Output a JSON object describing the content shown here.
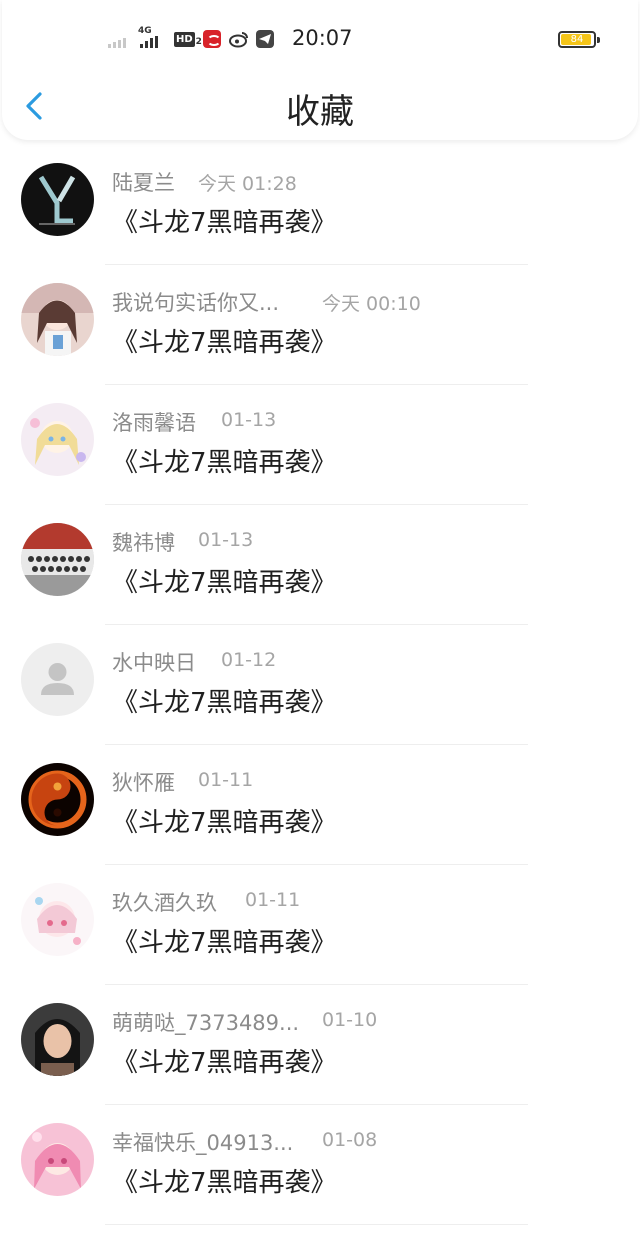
{
  "status_bar": {
    "network": "4G",
    "hd_label": "HD",
    "hd_sub": "2",
    "time": "20:07",
    "battery": "84"
  },
  "header": {
    "title": "收藏",
    "back_icon": "chevron-left-icon",
    "accent_color": "#2b9be0"
  },
  "items": [
    {
      "name": "陆夏兰",
      "date": "今天 01:28",
      "content": "《斗龙7黑暗再袭》",
      "avatar": "logo-y"
    },
    {
      "name": "我说句实话你又...",
      "date": "今天 00:10",
      "content": "《斗龙7黑暗再袭》",
      "avatar": "anime-girl"
    },
    {
      "name": "洛雨馨语",
      "date": "01-13",
      "content": "《斗龙7黑暗再袭》",
      "avatar": "anime-pastel"
    },
    {
      "name": "魏祎博",
      "date": "01-13",
      "content": "《斗龙7黑暗再袭》",
      "avatar": "group-photo"
    },
    {
      "name": "水中映日",
      "date": "01-12",
      "content": "《斗龙7黑暗再袭》",
      "avatar": "default-user"
    },
    {
      "name": "狄怀雁",
      "date": "01-11",
      "content": "《斗龙7黑暗再袭》",
      "avatar": "fire-yinyang"
    },
    {
      "name": "玖久酒久玖",
      "date": "01-11",
      "content": "《斗龙7黑暗再袭》",
      "avatar": "anime-chibi"
    },
    {
      "name": "萌萌哒_7373489...",
      "date": "01-10",
      "content": "《斗龙7黑暗再袭》",
      "avatar": "person-photo"
    },
    {
      "name": "幸福快乐_04913...",
      "date": "01-08",
      "content": "《斗龙7黑暗再袭》",
      "avatar": "anime-pink"
    }
  ]
}
